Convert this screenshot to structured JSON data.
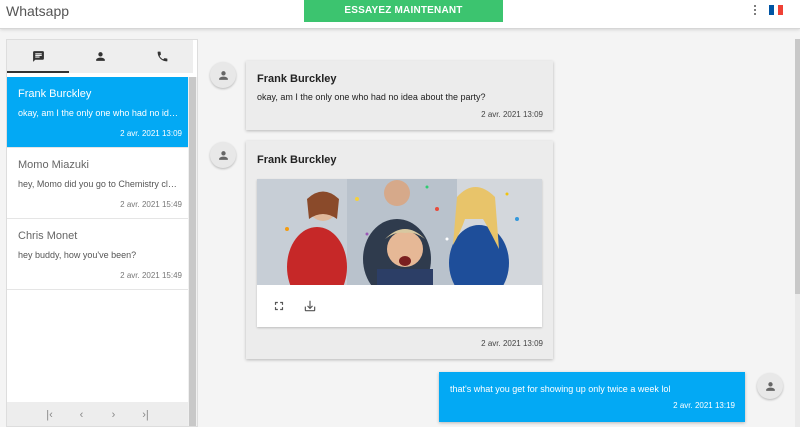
{
  "app": {
    "title": "Whatsapp",
    "cta_label": "ESSAYEZ MAINTENANT",
    "menu_icon": "kebab-menu-icon",
    "language_flag": "french-flag-icon",
    "flag_colors": [
      "#0055a4",
      "#ffffff",
      "#ef4135"
    ]
  },
  "colors": {
    "accent": "#03a9f4",
    "cta": "#3cc46f",
    "bubble_incoming": "#ececec"
  },
  "sidebar": {
    "tabs": [
      {
        "icon": "chat-icon",
        "active": true
      },
      {
        "icon": "person-icon",
        "active": false
      },
      {
        "icon": "phone-icon",
        "active": false
      }
    ],
    "conversations": [
      {
        "name": "Frank Burckley",
        "preview": "okay, am I the only one who had no idea about the party?",
        "time": "2 avr. 2021 13:09",
        "selected": true
      },
      {
        "name": "Momo Miazuki",
        "preview": "hey, Momo did you go to Chemistry class?",
        "time": "2 avr. 2021 15:49",
        "selected": false
      },
      {
        "name": "Chris Monet",
        "preview": "hey buddy, how you've been?",
        "time": "2 avr. 2021 15:49",
        "selected": false
      }
    ],
    "pager": {
      "first": "|‹",
      "prev": "‹",
      "next": "›",
      "last": "›|"
    }
  },
  "chat": {
    "messages": [
      {
        "sender": "Frank Burckley",
        "text": "okay, am I the only one who had no idea about the party?",
        "time": "2 avr. 2021 13:09",
        "own": false,
        "type": "text"
      },
      {
        "sender": "Frank Burckley",
        "time": "2 avr. 2021 13:09",
        "own": false,
        "type": "image",
        "image_subject": "party-photo",
        "actions": [
          "fullscreen-icon",
          "download-icon"
        ]
      },
      {
        "sender": "",
        "text": "that's what you get for showing up only twice a week lol",
        "time": "2 avr. 2021 13:19",
        "own": true,
        "type": "text"
      }
    ]
  }
}
